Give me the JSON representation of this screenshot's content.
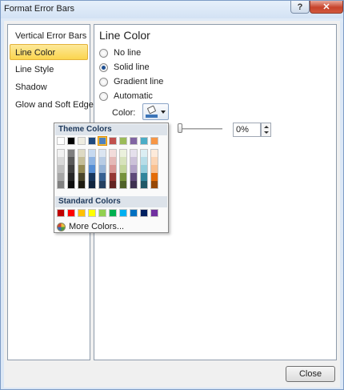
{
  "window": {
    "title": "Format Error Bars",
    "help_label": "?",
    "close_label": "✕"
  },
  "nav": {
    "items": [
      {
        "label": "Vertical Error Bars"
      },
      {
        "label": "Line Color",
        "selected": true
      },
      {
        "label": "Line Style"
      },
      {
        "label": "Shadow"
      },
      {
        "label": "Glow and Soft Edges"
      }
    ]
  },
  "pane": {
    "title": "Line Color",
    "options": [
      {
        "label": "No line",
        "checked": false
      },
      {
        "label": "Solid line",
        "checked": true
      },
      {
        "label": "Gradient line",
        "checked": false
      },
      {
        "label": "Automatic",
        "checked": false
      }
    ],
    "color_label": "Color:",
    "transparency_value": "0%"
  },
  "picker": {
    "theme_header": "Theme Colors",
    "standard_header": "Standard Colors",
    "more_colors_label": "More Colors...",
    "theme_colors": [
      "#ffffff",
      "#000000",
      "#eeece1",
      "#1f497d",
      "#4f81bd",
      "#c0504d",
      "#9bbb59",
      "#8064a2",
      "#4bacc6",
      "#f79646"
    ],
    "theme_shades": [
      [
        "#f2f2f2",
        "#d9d9d9",
        "#bfbfbf",
        "#a6a6a6",
        "#808080"
      ],
      [
        "#7f7f7f",
        "#595959",
        "#3f3f3f",
        "#262626",
        "#0d0d0d"
      ],
      [
        "#ddd9c3",
        "#c4bd97",
        "#938953",
        "#4a452a",
        "#1d1b10"
      ],
      [
        "#c6d9f0",
        "#8db3e2",
        "#548dd4",
        "#17365d",
        "#0f243e"
      ],
      [
        "#dbe5f1",
        "#b8cce4",
        "#95b3d7",
        "#366092",
        "#244061"
      ],
      [
        "#f2dcdb",
        "#e5b9b7",
        "#d99694",
        "#953734",
        "#632423"
      ],
      [
        "#ebf1dd",
        "#d7e3bc",
        "#c3d69b",
        "#76923c",
        "#4f6128"
      ],
      [
        "#e5e0ec",
        "#ccc1d9",
        "#b2a2c7",
        "#5f497a",
        "#3f3151"
      ],
      [
        "#dbeef3",
        "#b7dde8",
        "#92cddc",
        "#31859b",
        "#205867"
      ],
      [
        "#fdeada",
        "#fbd5b5",
        "#fac08f",
        "#e36c09",
        "#974806"
      ]
    ],
    "selected_theme_index": 4,
    "standard_colors": [
      "#c00000",
      "#ff0000",
      "#ffc000",
      "#ffff00",
      "#92d050",
      "#00b050",
      "#00b0f0",
      "#0070c0",
      "#002060",
      "#7030a0"
    ]
  },
  "footer": {
    "close_label": "Close"
  }
}
